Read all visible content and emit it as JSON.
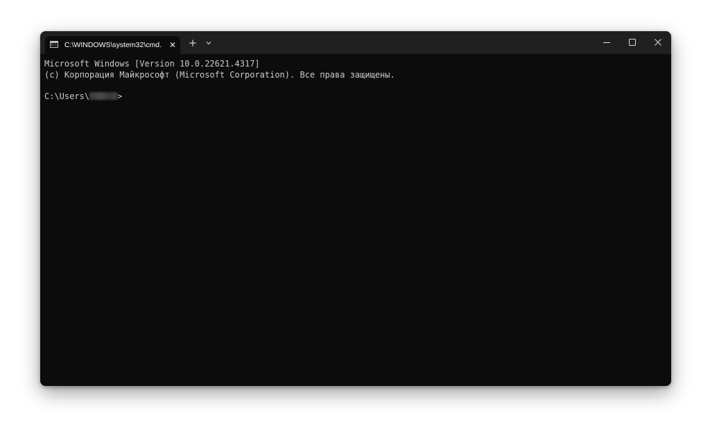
{
  "tab": {
    "title": "C:\\WINDOWS\\system32\\cmd.",
    "icon_text": "C:\\.",
    "close_glyph": "✕"
  },
  "toolbar": {
    "new_tab_glyph": "+",
    "dropdown_icon": "chevron-down-icon"
  },
  "window_controls": {
    "minimize_icon": "minimize-icon",
    "maximize_icon": "maximize-icon",
    "close_icon": "close-icon"
  },
  "console": {
    "lines": [
      "Microsoft Windows [Version 10.0.22621.4317]",
      "(c) Корпорация Майкрософт (Microsoft Corporation). Все права защищены."
    ],
    "prompt_prefix": "C:\\Users\\",
    "prompt_suffix": ">"
  },
  "colors": {
    "console_background": "#0c0c0c",
    "titlebar_background": "#202020",
    "console_text": "#cccccc"
  }
}
